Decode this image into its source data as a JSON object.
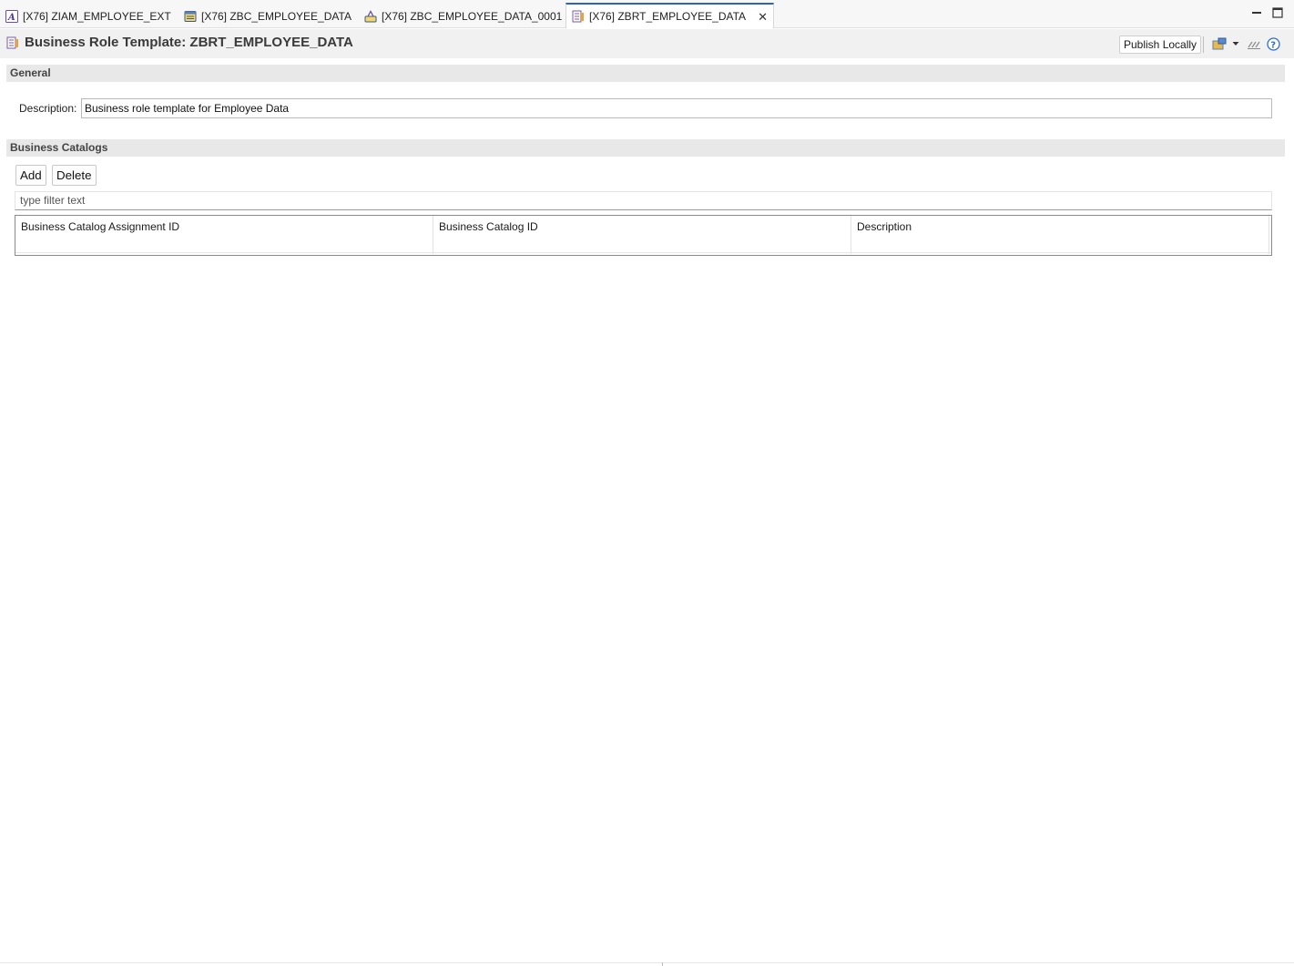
{
  "tabs": [
    {
      "label": "[X76] ZIAM_EMPLOYEE_EXT",
      "icon": "app-letter-icon"
    },
    {
      "label": "[X76] ZBC_EMPLOYEE_DATA",
      "icon": "catalog-icon"
    },
    {
      "label": "[X76] ZBC_EMPLOYEE_DATA_0001",
      "icon": "catalog-item-icon"
    },
    {
      "label": "[X76] ZBRT_EMPLOYEE_DATA",
      "icon": "role-template-icon",
      "active": true
    }
  ],
  "header": {
    "title": "Business Role Template: ZBRT_EMPLOYEE_DATA",
    "publish_label": "Publish Locally"
  },
  "general": {
    "section_title": "General",
    "description_label": "Description:",
    "description_value": "Business role template for Employee Data"
  },
  "catalogs": {
    "section_title": "Business Catalogs",
    "add_label": "Add",
    "delete_label": "Delete",
    "filter_placeholder": "type filter text",
    "columns": [
      "Business Catalog Assignment ID",
      "Business Catalog ID",
      "Description"
    ]
  },
  "colors": {
    "active_tab_accent": "#2b63c4",
    "section_bg": "#e8e8e8",
    "header_bg": "#f1f1f1"
  }
}
